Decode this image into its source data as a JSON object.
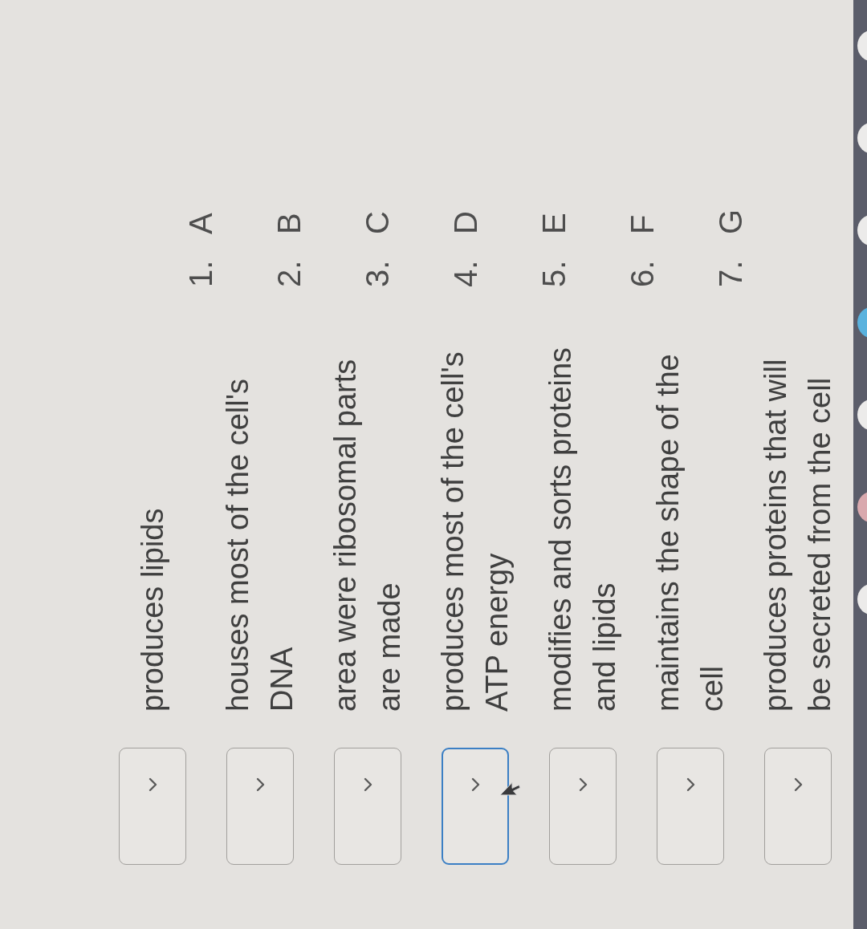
{
  "matching_rows": [
    {
      "description": "produces lipids",
      "focused": false
    },
    {
      "description": "houses most of the cell's DNA",
      "focused": false
    },
    {
      "description": "area were ribosomal parts are made",
      "focused": false
    },
    {
      "description": "produces most of the cell's ATP energy",
      "focused": true
    },
    {
      "description": "modifies and sorts proteins and lipids",
      "focused": false
    },
    {
      "description": "maintains the shape of the cell",
      "focused": false
    },
    {
      "description": "produces proteins that will be secreted from the cell",
      "focused": false
    }
  ],
  "letter_list": [
    {
      "number": "1.",
      "letter": "A"
    },
    {
      "number": "2.",
      "letter": "B"
    },
    {
      "number": "3.",
      "letter": "C"
    },
    {
      "number": "4.",
      "letter": "D"
    },
    {
      "number": "5.",
      "letter": "E"
    },
    {
      "number": "6.",
      "letter": "F"
    },
    {
      "number": "7.",
      "letter": "G"
    }
  ]
}
